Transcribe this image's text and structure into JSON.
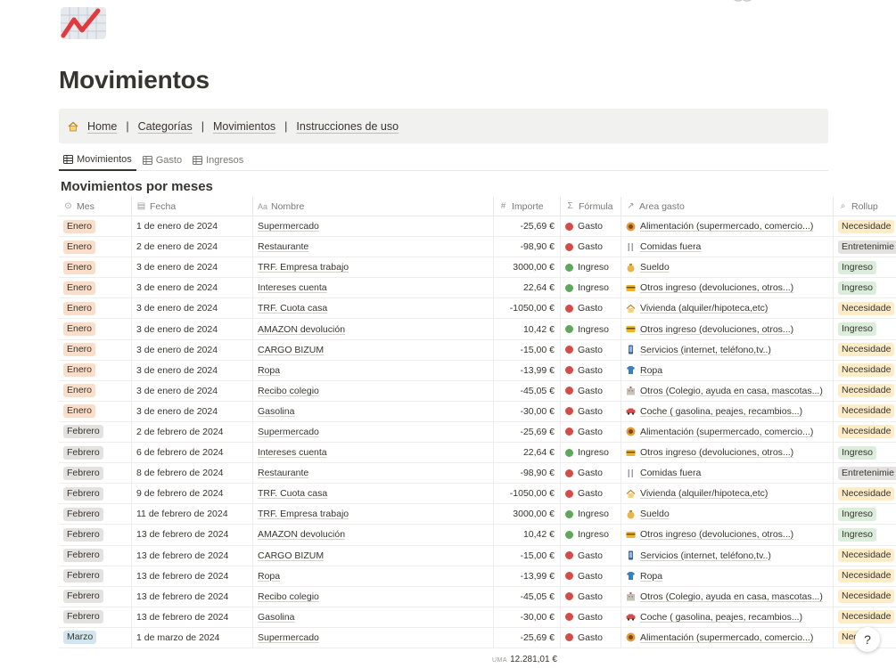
{
  "page": {
    "icon": "chart-trend-icon",
    "title": "Movimientos"
  },
  "nav": {
    "links": [
      "Home",
      "Categorías",
      "Movimientos",
      "Instrucciones de uso"
    ],
    "separator": "|"
  },
  "views": [
    {
      "label": "Movimientos",
      "icon": "table-icon",
      "active": true
    },
    {
      "label": "Gasto",
      "icon": "table-icon",
      "active": false
    },
    {
      "label": "Ingresos",
      "icon": "table-icon",
      "active": false
    }
  ],
  "section_title": "Movimientos por meses",
  "columns": {
    "mes": "Mes",
    "fecha": "Fecha",
    "nombre": "Nombre",
    "importe": "Importe",
    "formula": "Fórmula",
    "area": "Area gasto",
    "rollup": "Rollup"
  },
  "rows": [
    {
      "mes": "Enero",
      "fecha": "1 de enero de 2024",
      "nombre": "Supermercado",
      "importe": "-25,69 €",
      "formula": "Gasto",
      "area": "Alimentación (supermercado, comercio...)",
      "area_icon": "food-icon",
      "rollup": "Necesidade"
    },
    {
      "mes": "Enero",
      "fecha": "2 de enero de 2024",
      "nombre": "Restaurante",
      "importe": "-98,90 €",
      "formula": "Gasto",
      "area": "Comidas fuera",
      "area_icon": "cutlery-icon",
      "rollup": "Entretenimie"
    },
    {
      "mes": "Enero",
      "fecha": "3 de enero de 2024",
      "nombre": "TRF. Empresa trabajo",
      "importe": "3000,00 €",
      "formula": "Ingreso",
      "area": "Sueldo",
      "area_icon": "money-bag-icon",
      "rollup": "Ingreso"
    },
    {
      "mes": "Enero",
      "fecha": "3 de enero de 2024",
      "nombre": "Intereses cuenta",
      "importe": "22,64 €",
      "formula": "Ingreso",
      "area": "Otros ingreso (devoluciones, otros...)",
      "area_icon": "card-icon",
      "rollup": "Ingreso"
    },
    {
      "mes": "Enero",
      "fecha": "3 de enero de 2024",
      "nombre": "TRF. Cuota casa",
      "importe": "-1050,00 €",
      "formula": "Gasto",
      "area": "Vivienda (alquiler/hipoteca,etc)",
      "area_icon": "house-icon",
      "rollup": "Necesidade"
    },
    {
      "mes": "Enero",
      "fecha": "3 de enero de 2024",
      "nombre": "AMAZON devolución",
      "importe": "10,42 €",
      "formula": "Ingreso",
      "area": "Otros ingreso (devoluciones, otros...)",
      "area_icon": "card-icon",
      "rollup": "Ingreso"
    },
    {
      "mes": "Enero",
      "fecha": "3 de enero de 2024",
      "nombre": "CARGO BIZUM",
      "importe": "-15,00 €",
      "formula": "Gasto",
      "area": "Servicios (internet, teléfono,tv..)",
      "area_icon": "phone-icon",
      "rollup": "Necesidade"
    },
    {
      "mes": "Enero",
      "fecha": "3 de enero de 2024",
      "nombre": "Ropa",
      "importe": "-13,99 €",
      "formula": "Gasto",
      "area": "Ropa",
      "area_icon": "shirt-icon",
      "rollup": "Necesidade"
    },
    {
      "mes": "Enero",
      "fecha": "3 de enero de 2024",
      "nombre": "Recibo colegio",
      "importe": "-45,05 €",
      "formula": "Gasto",
      "area": "Otros (Colegio, ayuda en casa, mascotas...)",
      "area_icon": "school-icon",
      "rollup": "Necesidade"
    },
    {
      "mes": "Enero",
      "fecha": "3 de enero de 2024",
      "nombre": "Gasolina",
      "importe": "-30,00 €",
      "formula": "Gasto",
      "area": "Coche ( gasolina, peajes, recambios...)",
      "area_icon": "car-icon",
      "rollup": "Necesidade"
    },
    {
      "mes": "Febrero",
      "fecha": "2 de febrero de 2024",
      "nombre": "Supermercado",
      "importe": "-25,69 €",
      "formula": "Gasto",
      "area": "Alimentación (supermercado, comercio...)",
      "area_icon": "food-icon",
      "rollup": "Necesidade"
    },
    {
      "mes": "Febrero",
      "fecha": "6 de febrero de 2024",
      "nombre": "Intereses cuenta",
      "importe": "22,64 €",
      "formula": "Ingreso",
      "area": "Otros ingreso (devoluciones, otros...)",
      "area_icon": "card-icon",
      "rollup": "Ingreso"
    },
    {
      "mes": "Febrero",
      "fecha": "8 de febrero de 2024",
      "nombre": "Restaurante",
      "importe": "-98,90 €",
      "formula": "Gasto",
      "area": "Comidas fuera",
      "area_icon": "cutlery-icon",
      "rollup": "Entretenimie"
    },
    {
      "mes": "Febrero",
      "fecha": "9 de febrero de 2024",
      "nombre": "TRF. Cuota casa",
      "importe": "-1050,00 €",
      "formula": "Gasto",
      "area": "Vivienda (alquiler/hipoteca,etc)",
      "area_icon": "house-icon",
      "rollup": "Necesidade"
    },
    {
      "mes": "Febrero",
      "fecha": "11 de febrero de 2024",
      "nombre": "TRF. Empresa trabajo",
      "importe": "3000,00 €",
      "formula": "Ingreso",
      "area": "Sueldo",
      "area_icon": "money-bag-icon",
      "rollup": "Ingreso"
    },
    {
      "mes": "Febrero",
      "fecha": "13 de febrero de 2024",
      "nombre": "AMAZON devolución",
      "importe": "10,42 €",
      "formula": "Ingreso",
      "area": "Otros ingreso (devoluciones, otros...)",
      "area_icon": "card-icon",
      "rollup": "Ingreso"
    },
    {
      "mes": "Febrero",
      "fecha": "13 de febrero de 2024",
      "nombre": "CARGO BIZUM",
      "importe": "-15,00 €",
      "formula": "Gasto",
      "area": "Servicios (internet, teléfono,tv..)",
      "area_icon": "phone-icon",
      "rollup": "Necesidade"
    },
    {
      "mes": "Febrero",
      "fecha": "13 de febrero de 2024",
      "nombre": "Ropa",
      "importe": "-13,99 €",
      "formula": "Gasto",
      "area": "Ropa",
      "area_icon": "shirt-icon",
      "rollup": "Necesidade"
    },
    {
      "mes": "Febrero",
      "fecha": "13 de febrero de 2024",
      "nombre": "Recibo colegio",
      "importe": "-45,05 €",
      "formula": "Gasto",
      "area": "Otros (Colegio, ayuda en casa, mascotas...)",
      "area_icon": "school-icon",
      "rollup": "Necesidade"
    },
    {
      "mes": "Febrero",
      "fecha": "13 de febrero de 2024",
      "nombre": "Gasolina",
      "importe": "-30,00 €",
      "formula": "Gasto",
      "area": "Coche ( gasolina, peajes, recambios...)",
      "area_icon": "car-icon",
      "rollup": "Necesidade"
    },
    {
      "mes": "Marzo",
      "fecha": "1 de marzo de 2024",
      "nombre": "Supermercado",
      "importe": "-25,69 €",
      "formula": "Gasto",
      "area": "Alimentación (supermercado, comercio...)",
      "area_icon": "food-icon",
      "rollup": "Nec"
    }
  ],
  "footer": {
    "sum_label": "UMA",
    "sum_value": "12.281,01 €"
  },
  "help": {
    "label": "?"
  },
  "colors": {
    "gasto_dot": "#d44c47",
    "ingreso_dot": "#5fa75a",
    "nav_bg": "#f1f1ef"
  }
}
